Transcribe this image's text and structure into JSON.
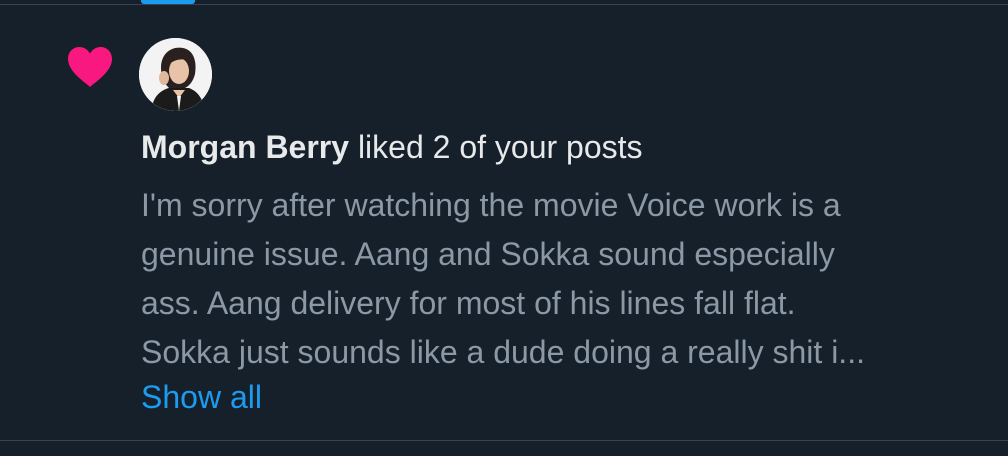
{
  "colors": {
    "background": "#15202b",
    "heart": "#f91880",
    "link": "#1d9bf0",
    "primary_text": "#e7e9ea",
    "secondary_text": "#8b98a5",
    "divider": "#38444d"
  },
  "notification": {
    "icon": "heart-icon",
    "user_name": "Morgan Berry",
    "action_text": "liked 2 of your posts",
    "post_lines": [
      "I'm sorry after watching the movie Voice work is a",
      "genuine issue. Aang and Sokka sound especially",
      "ass. Aang delivery for most of his lines fall flat.",
      "Sokka just sounds like a dude doing a really shit i..."
    ],
    "show_all_label": "Show all"
  }
}
